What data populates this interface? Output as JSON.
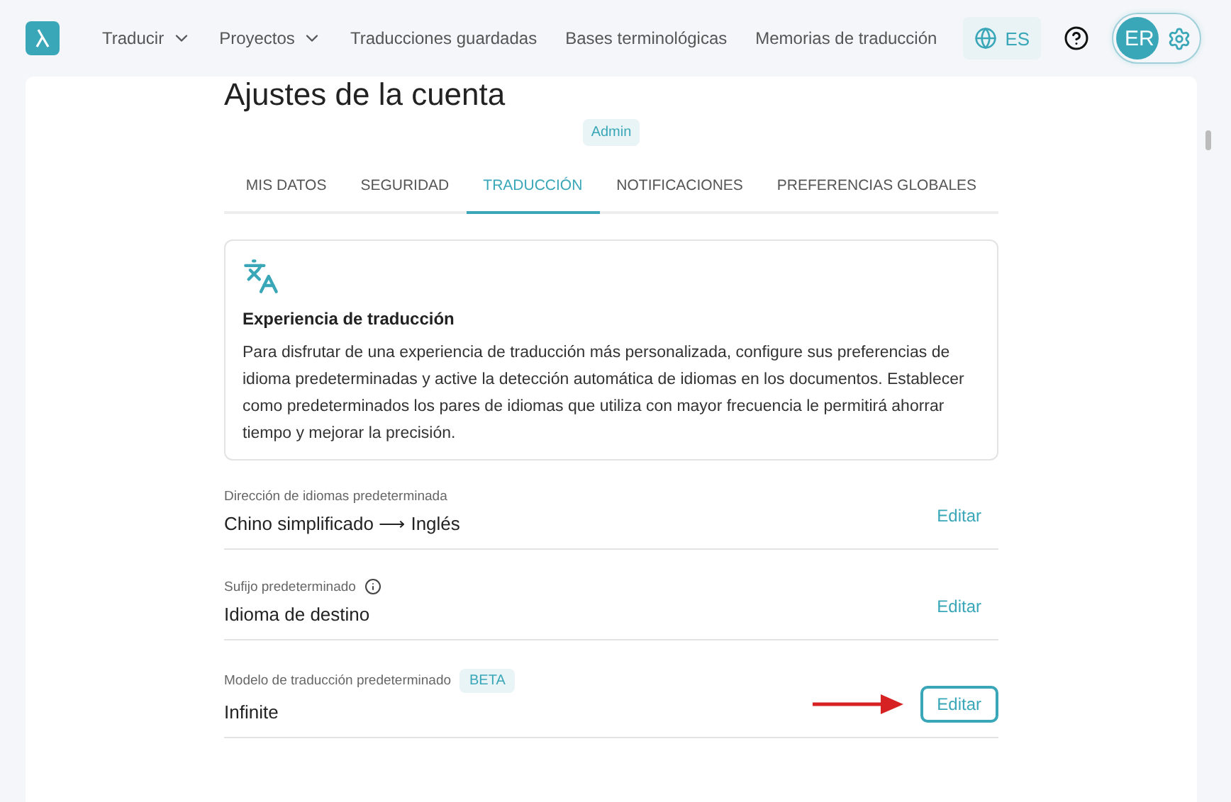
{
  "nav": {
    "items": [
      {
        "label": "Traducir",
        "dropdown": true
      },
      {
        "label": "Proyectos",
        "dropdown": true
      },
      {
        "label": "Traducciones guardadas",
        "dropdown": false
      },
      {
        "label": "Bases terminológicas",
        "dropdown": false
      },
      {
        "label": "Memorias de traducción",
        "dropdown": false
      }
    ],
    "language": "ES",
    "avatar": "ER"
  },
  "page": {
    "title": "Ajustes de la cuenta",
    "role_badge": "Admin"
  },
  "tabs": [
    {
      "label": "MIS DATOS",
      "selected": false
    },
    {
      "label": "SEGURIDAD",
      "selected": false
    },
    {
      "label": "TRADUCCIÓN",
      "selected": true
    },
    {
      "label": "NOTIFICACIONES",
      "selected": false
    },
    {
      "label": "PREFERENCIAS GLOBALES",
      "selected": false
    }
  ],
  "info_card": {
    "title": "Experiencia de traducción",
    "text": "Para disfrutar de una experiencia de traducción más personalizada, configure sus preferencias de idioma predeterminadas y active la detección automática de idiomas en los documentos. Establecer como predeterminados los pares de idiomas que utiliza con mayor frecuencia le permitirá ahorrar tiempo y mejorar la precisión."
  },
  "settings": [
    {
      "label": "Dirección de idiomas predeterminada",
      "value": "Chino simplificado ⟶ Inglés",
      "action": "Editar",
      "info": false,
      "highlighted": false
    },
    {
      "label": "Sufijo predeterminado",
      "value": "Idioma de destino",
      "action": "Editar",
      "info": true,
      "highlighted": false
    },
    {
      "label": "Modelo de traducción predeterminado",
      "badge": "BETA",
      "value": "Infinite",
      "action": "Editar",
      "info": false,
      "highlighted": true
    }
  ]
}
